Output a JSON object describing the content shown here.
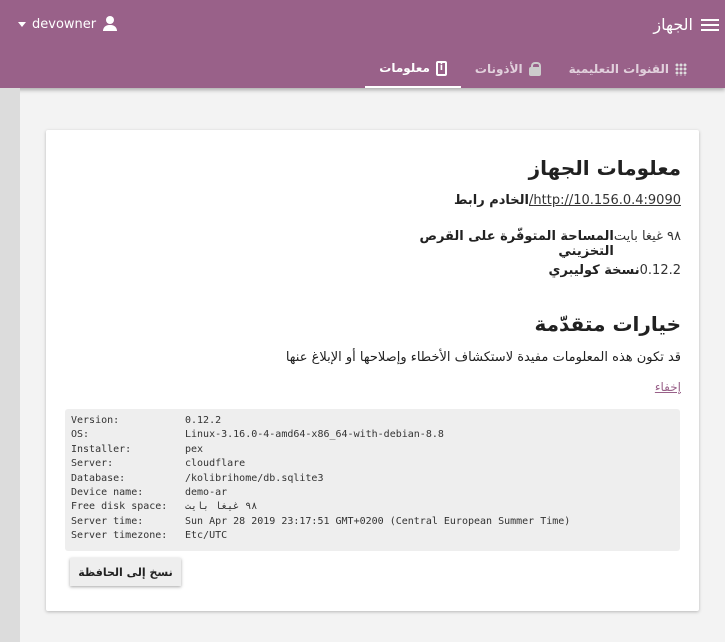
{
  "header": {
    "title": "الجهاز",
    "user": "devowner"
  },
  "tabs": [
    {
      "label": "القنوات التعليمية"
    },
    {
      "label": "الأذونات"
    },
    {
      "label": "معلومات"
    }
  ],
  "device_info": {
    "title": "معلومات الجهاز",
    "rows": [
      {
        "label": "الخادم رابط",
        "value": "http://10.156.0.4:9090/"
      },
      {
        "label": "المساحة المتوفّرة على القرص التخزيني",
        "value": "٩٨ غيغا بايت"
      },
      {
        "label": "نسخة كوليبري",
        "value": "0.12.2"
      }
    ]
  },
  "advanced": {
    "title": "خيارات متقدّمة",
    "description": "قد تكون هذه المعلومات مفيدة لاستكشاف الأخطاء وإصلاحها أو الإبلاغ عنها",
    "hide_link": "إخفاء",
    "details": [
      {
        "k": "Version:",
        "v": "0.12.2"
      },
      {
        "k": "OS:",
        "v": "Linux-3.16.0-4-amd64-x86_64-with-debian-8.8"
      },
      {
        "k": "Installer:",
        "v": "pex"
      },
      {
        "k": "Server:",
        "v": "cloudflare"
      },
      {
        "k": "Database:",
        "v": "/kolibrihome/db.sqlite3"
      },
      {
        "k": "Device name:",
        "v": "demo-ar"
      },
      {
        "k": "Free disk space:",
        "v": "٩٨ غيغا بايت"
      },
      {
        "k": "Server time:",
        "v": "Sun Apr 28 2019 23:17:51 GMT+0200 (Central European Summer Time)"
      },
      {
        "k": "Server timezone:",
        "v": "Etc/UTC"
      }
    ],
    "copy_button": "نسخ إلى الحافظة"
  }
}
